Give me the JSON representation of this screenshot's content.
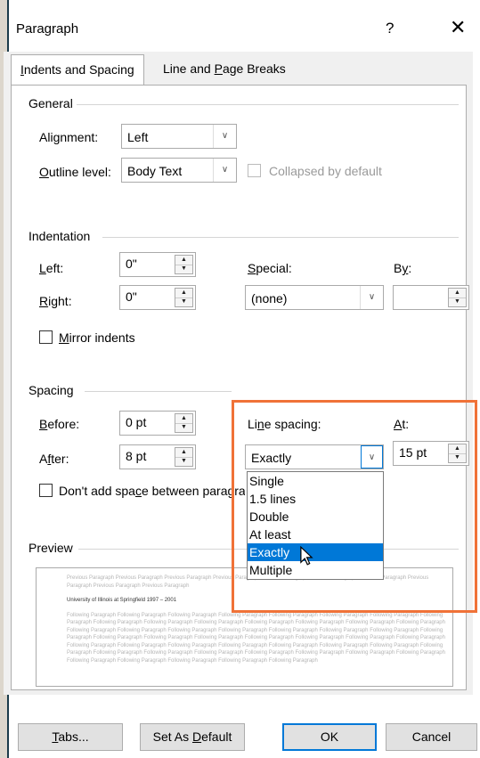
{
  "dialog": {
    "title": "Paragraph",
    "help": "?",
    "close": "✕"
  },
  "tabs": [
    {
      "pre": "",
      "key": "I",
      "post": "ndents and Spacing"
    },
    {
      "pre": "Line and ",
      "key": "P",
      "post": "age Breaks"
    }
  ],
  "general": {
    "section": "General",
    "alignment": {
      "pre": "Ali",
      "key": "g",
      "post": "nment:",
      "value": "Left"
    },
    "outline": {
      "pre": "",
      "key": "O",
      "post": "utline level:",
      "value": "Body Text"
    },
    "collapsed": "Collapsed by default"
  },
  "indentation": {
    "section": "Indentation",
    "left": {
      "pre": "",
      "key": "L",
      "post": "eft:",
      "value": "0\""
    },
    "right": {
      "pre": "",
      "key": "R",
      "post": "ight:",
      "value": "0\""
    },
    "special": {
      "pre": "",
      "key": "S",
      "post": "pecial:",
      "value": "(none)"
    },
    "by": {
      "pre": "B",
      "key": "y",
      "post": ":",
      "value": ""
    },
    "mirror": {
      "pre": "",
      "key": "M",
      "post": "irror indents"
    }
  },
  "spacing": {
    "section": "Spacing",
    "before": {
      "pre": "",
      "key": "B",
      "post": "efore:",
      "value": "0 pt"
    },
    "after": {
      "pre": "A",
      "key": "f",
      "post": "ter:",
      "value": "8 pt"
    },
    "line_spacing": {
      "pre": "Li",
      "key": "n",
      "post": "e spacing:",
      "value": "Exactly"
    },
    "at": {
      "pre": "",
      "key": "A",
      "post": "t:",
      "value": "15 pt"
    },
    "dont_add": {
      "pre": "Don't add spa",
      "key": "c",
      "post": "e between paragra"
    }
  },
  "dropdown_options": [
    {
      "label": "Single",
      "selected": false
    },
    {
      "label": "1.5 lines",
      "selected": false
    },
    {
      "label": "Double",
      "selected": false
    },
    {
      "label": "At least",
      "selected": false
    },
    {
      "label": "Exactly",
      "selected": true
    },
    {
      "label": "Multiple",
      "selected": false
    }
  ],
  "preview": {
    "section": "Preview",
    "previous": "Previous Paragraph Previous Paragraph Previous Paragraph Previous Paragraph Previous Paragraph Previous Paragraph Previous Paragraph Previous Paragraph Previous Paragraph Previous Paragraph",
    "current": "University of Illinois at Springfield 1997 – 2001",
    "following": "Following Paragraph Following Paragraph Following Paragraph Following Paragraph Following Paragraph Following Paragraph Following Paragraph Following Paragraph Following Paragraph Following Paragraph Following Paragraph Following Paragraph Following Paragraph Following Paragraph Following Paragraph Following Paragraph Following Paragraph Following Paragraph Following Paragraph Following Paragraph Following Paragraph Following Paragraph Following Paragraph Following Paragraph Following Paragraph Following Paragraph Following Paragraph Following Paragraph Following Paragraph Following Paragraph Following Paragraph Following Paragraph Following Paragraph Following Paragraph Following Paragraph Following Paragraph Following Paragraph Following Paragraph Following Paragraph Following Paragraph Following Paragraph Following Paragraph Following Paragraph Following Paragraph Following Paragraph Following Paragraph Following Paragraph Following Paragraph Following Paragraph Following Paragraph"
  },
  "buttons": {
    "tabs": {
      "pre": "",
      "key": "T",
      "post": "abs..."
    },
    "set_default": {
      "pre": "Set As ",
      "key": "D",
      "post": "efault"
    },
    "ok": "OK",
    "cancel": "Cancel"
  },
  "colors": {
    "highlight": "#f07238",
    "selection": "#0078d7"
  },
  "icons": {
    "dropdown": "chevron-down-icon",
    "spin_up": "spin-up-icon",
    "spin_down": "spin-down-icon",
    "cursor": "mouse-pointer-icon"
  }
}
